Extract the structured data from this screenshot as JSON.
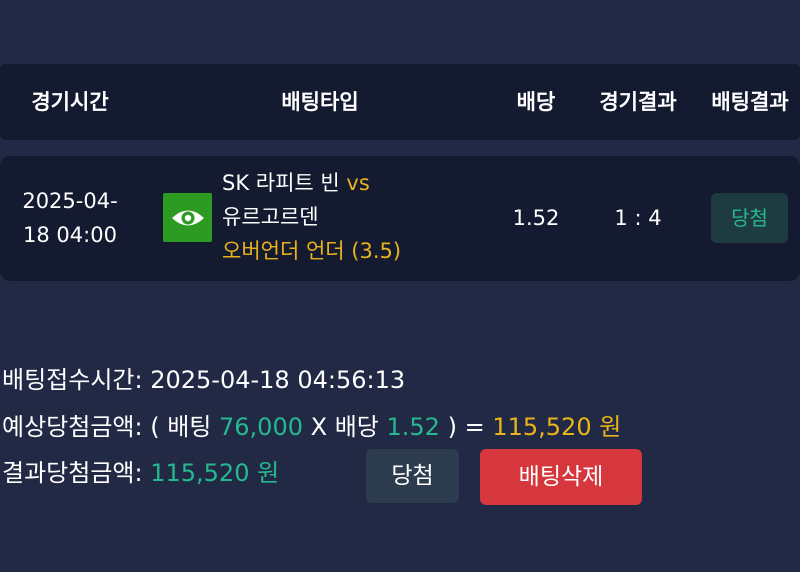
{
  "header": {
    "col_time": "경기시간",
    "col_bettype": "배팅타입",
    "col_odds": "배당",
    "col_game_result": "경기결과",
    "col_bet_result": "배팅결과"
  },
  "bet": {
    "time_line1": "2025-04-",
    "time_line2": "18 04:00",
    "sport_icon": "eye-icon",
    "home_team": "SK 라피트 빈",
    "vs": "vs",
    "away_team": "유르고르덴",
    "bet_type": "오버언더 언더",
    "bet_value": "(3.5)",
    "odds": "1.52",
    "score": "1 : 4",
    "result": "당첨"
  },
  "summary": {
    "received_label": "배팅접수시간:",
    "received_value": "2025-04-18 04:56:13",
    "expected_label": "예상당첨금액:",
    "open_paren": "( 배팅",
    "stake": "76,000",
    "times": "X 배당",
    "odds": "1.52",
    "close_eq": ") =",
    "expected_amount": "115,520 원",
    "actual_label": "결과당첨금액:",
    "actual_amount": "115,520 원"
  },
  "buttons": {
    "win_label": "당첨",
    "delete_label": "배팅삭제"
  },
  "colors": {
    "background": "#222944",
    "panel": "#141a30",
    "green": "#26b98f",
    "yellow": "#e9b41b",
    "delete": "#d6373d"
  }
}
